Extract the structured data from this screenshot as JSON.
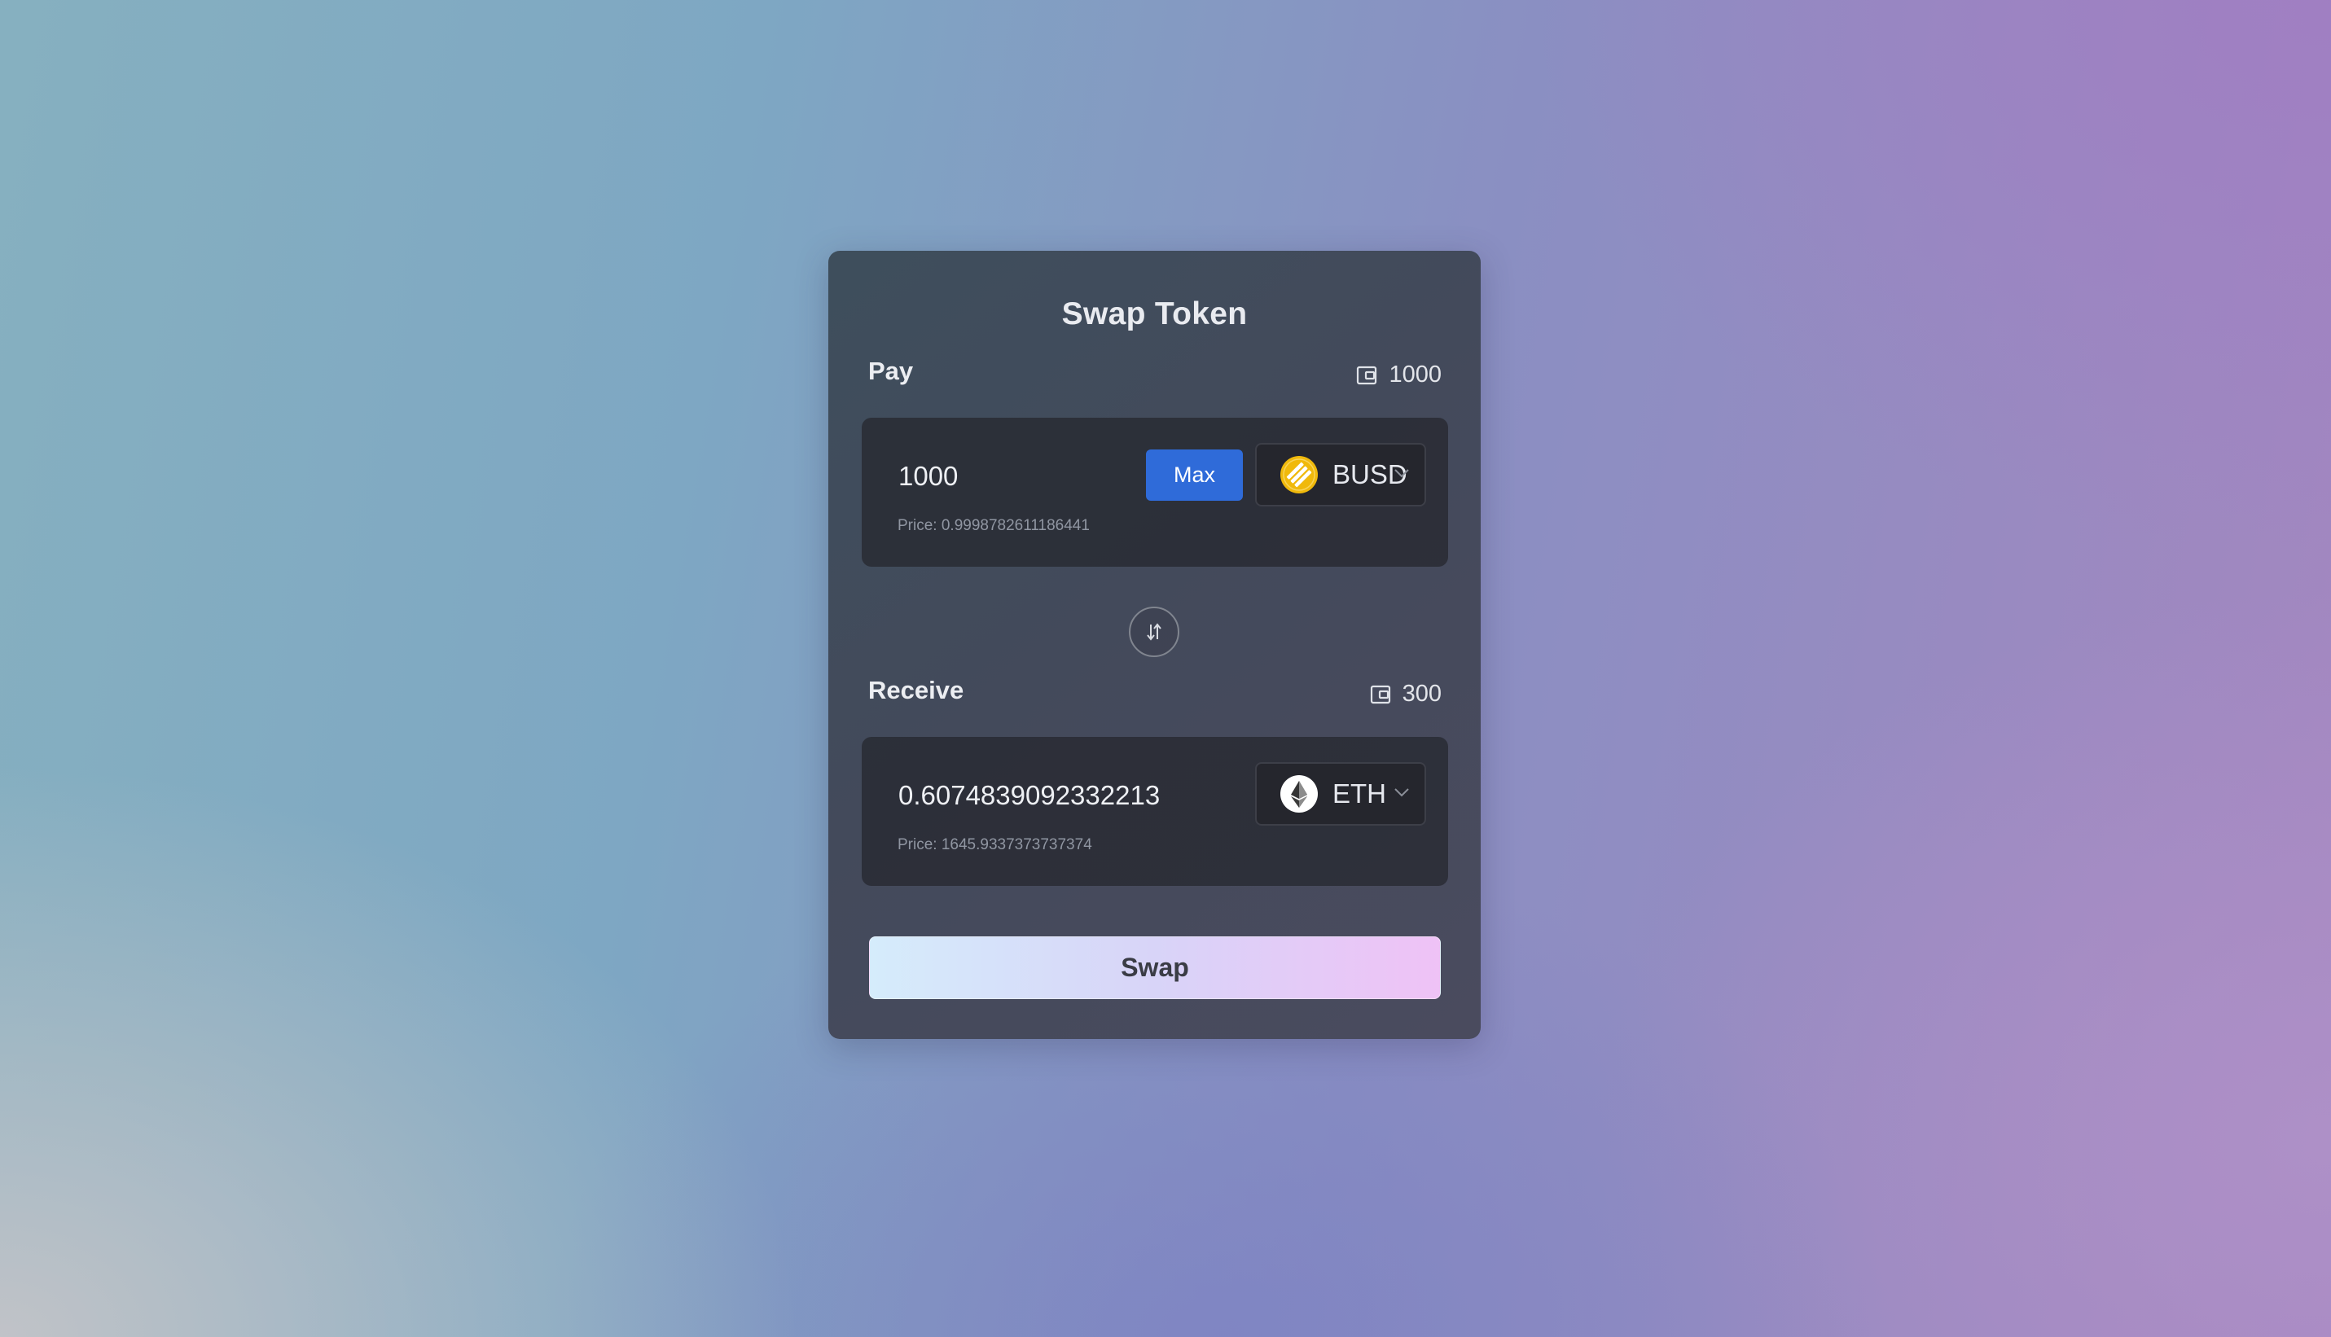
{
  "swap_card": {
    "title": "Swap Token",
    "pay": {
      "label": "Pay",
      "wallet_icon": "wallet-icon",
      "balance": "1000",
      "amount": "1000",
      "price_text": "Price: 0.9998782611186441",
      "max_label": "Max",
      "token": {
        "symbol": "BUSD",
        "icon": "busd-token-icon",
        "color": "#f0b90b"
      }
    },
    "switch_icon": "swap-arrows-icon",
    "receive": {
      "label": "Receive",
      "wallet_icon": "wallet-icon",
      "balance": "300",
      "amount": "0.6074839092332213",
      "price_text": "Price: 1645.9337373737374",
      "token": {
        "symbol": "ETH",
        "icon": "eth-token-icon",
        "color": "#ffffff"
      }
    },
    "swap_label": "Swap"
  },
  "colors": {
    "accent": "#2f6bd9",
    "card_bg": "#434a5b",
    "panel_bg": "#25262d",
    "swap_gradient_start": "#d5ecfb",
    "swap_gradient_end": "#efc2f6"
  }
}
